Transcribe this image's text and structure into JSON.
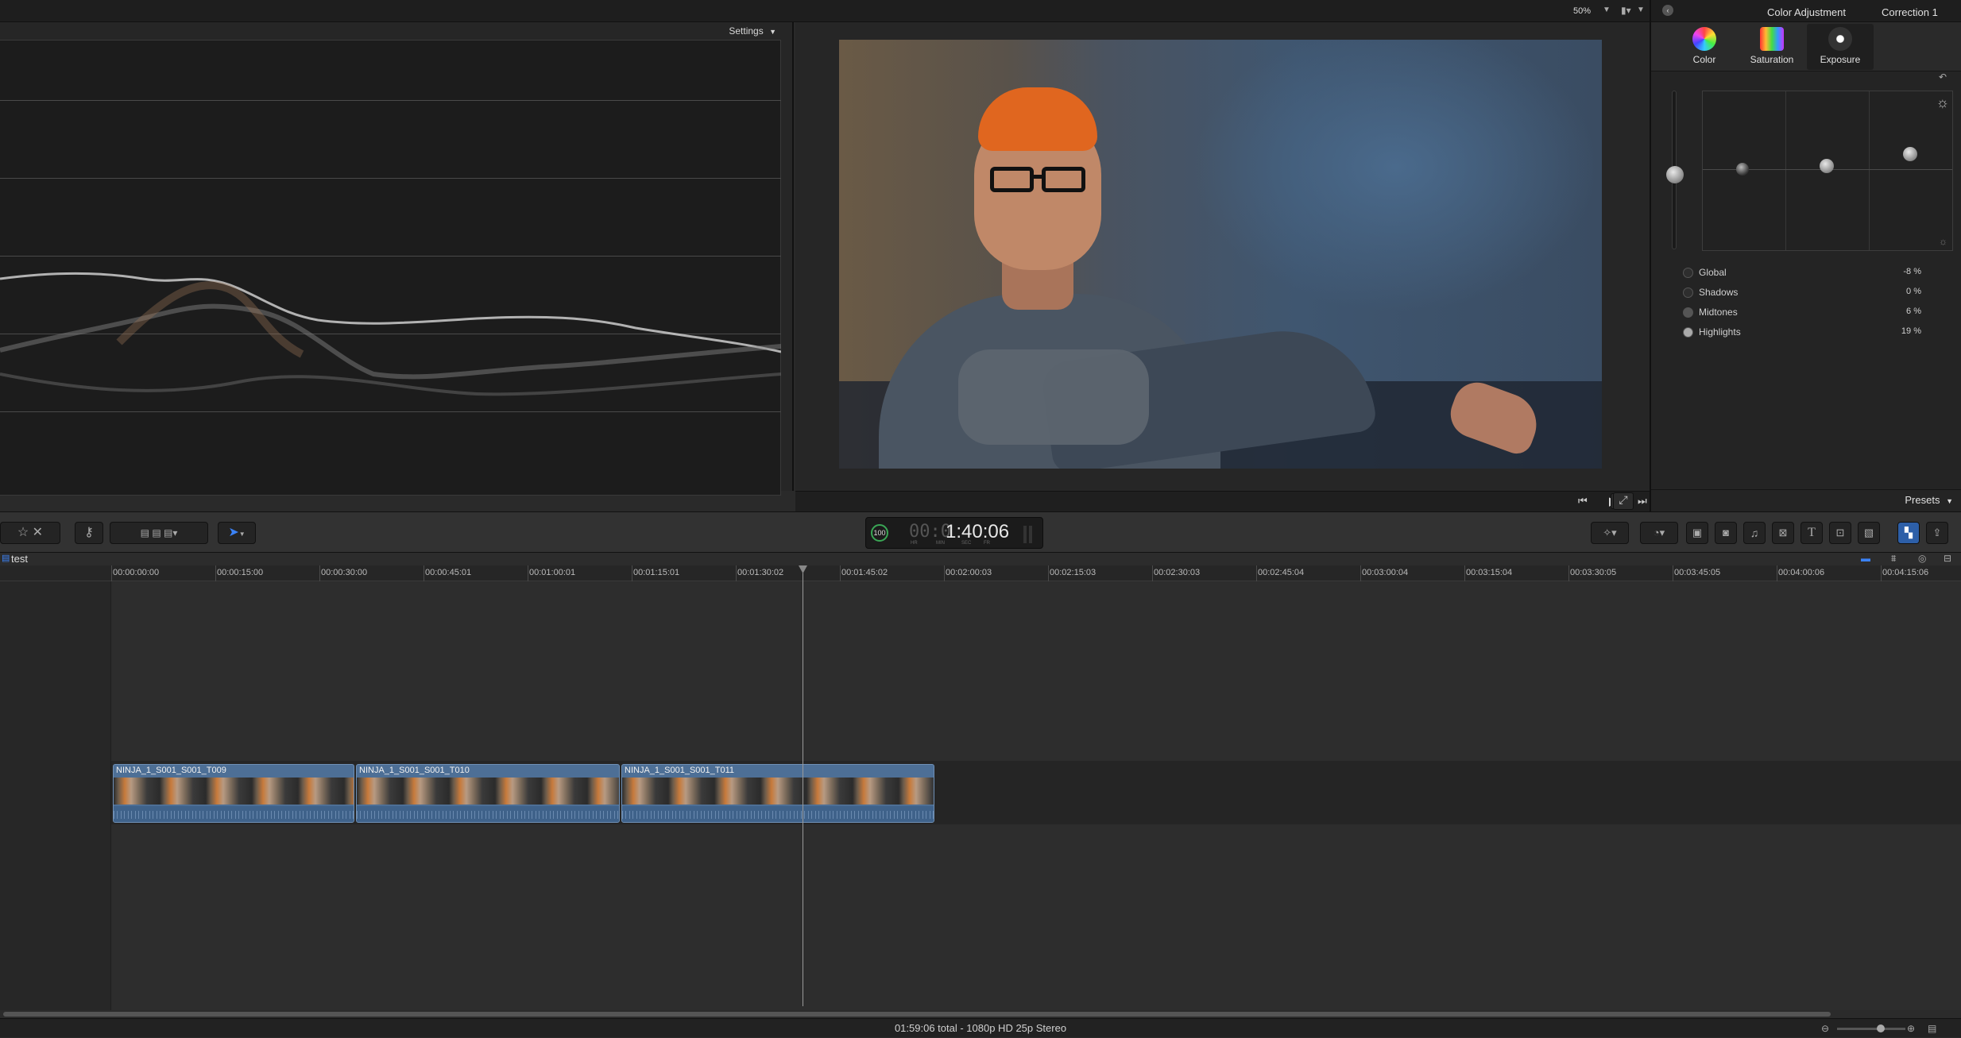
{
  "top": {
    "zoom": "50%",
    "inspector_title": "Color Adjustment",
    "correction": "Correction 1"
  },
  "scope": {
    "settings_label": "Settings"
  },
  "inspector": {
    "tabs": [
      {
        "label": "Color"
      },
      {
        "label": "Saturation"
      },
      {
        "label": "Exposure"
      }
    ],
    "rows": [
      {
        "label": "Global",
        "value": "-8 %"
      },
      {
        "label": "Shadows",
        "value": "0 %"
      },
      {
        "label": "Midtones",
        "value": "6 %"
      },
      {
        "label": "Highlights",
        "value": "19 %"
      }
    ],
    "presets_label": "Presets"
  },
  "toolbar": {
    "timecode": "1:40:06",
    "timecode_dim": "00:0",
    "tc_units": [
      "HR",
      "MIN",
      "SEC",
      "FR"
    ],
    "meter_value": "100"
  },
  "timeline": {
    "project_name": "test",
    "ruler": [
      "00:00:00:00",
      "00:00:15:00",
      "00:00:30:00",
      "00:00:45:01",
      "00:01:00:01",
      "00:01:15:01",
      "00:01:30:02",
      "00:01:45:02",
      "00:02:00:03",
      "00:02:15:03",
      "00:02:30:03",
      "00:02:45:04",
      "00:03:00:04",
      "00:03:15:04",
      "00:03:30:05",
      "00:03:45:05",
      "00:04:00:06",
      "00:04:15:06"
    ],
    "clips": [
      {
        "name": "NINJA_1_S001_S001_T009"
      },
      {
        "name": "NINJA_1_S001_S001_T010"
      },
      {
        "name": "NINJA_1_S001_S001_T011"
      }
    ]
  },
  "status": {
    "text": "01:59:06 total - 1080p HD 25p Stereo"
  },
  "colors": {
    "clip_blue": "#4d6f96",
    "accent_blue": "#3b82f6",
    "tc_green": "#3aa655"
  }
}
